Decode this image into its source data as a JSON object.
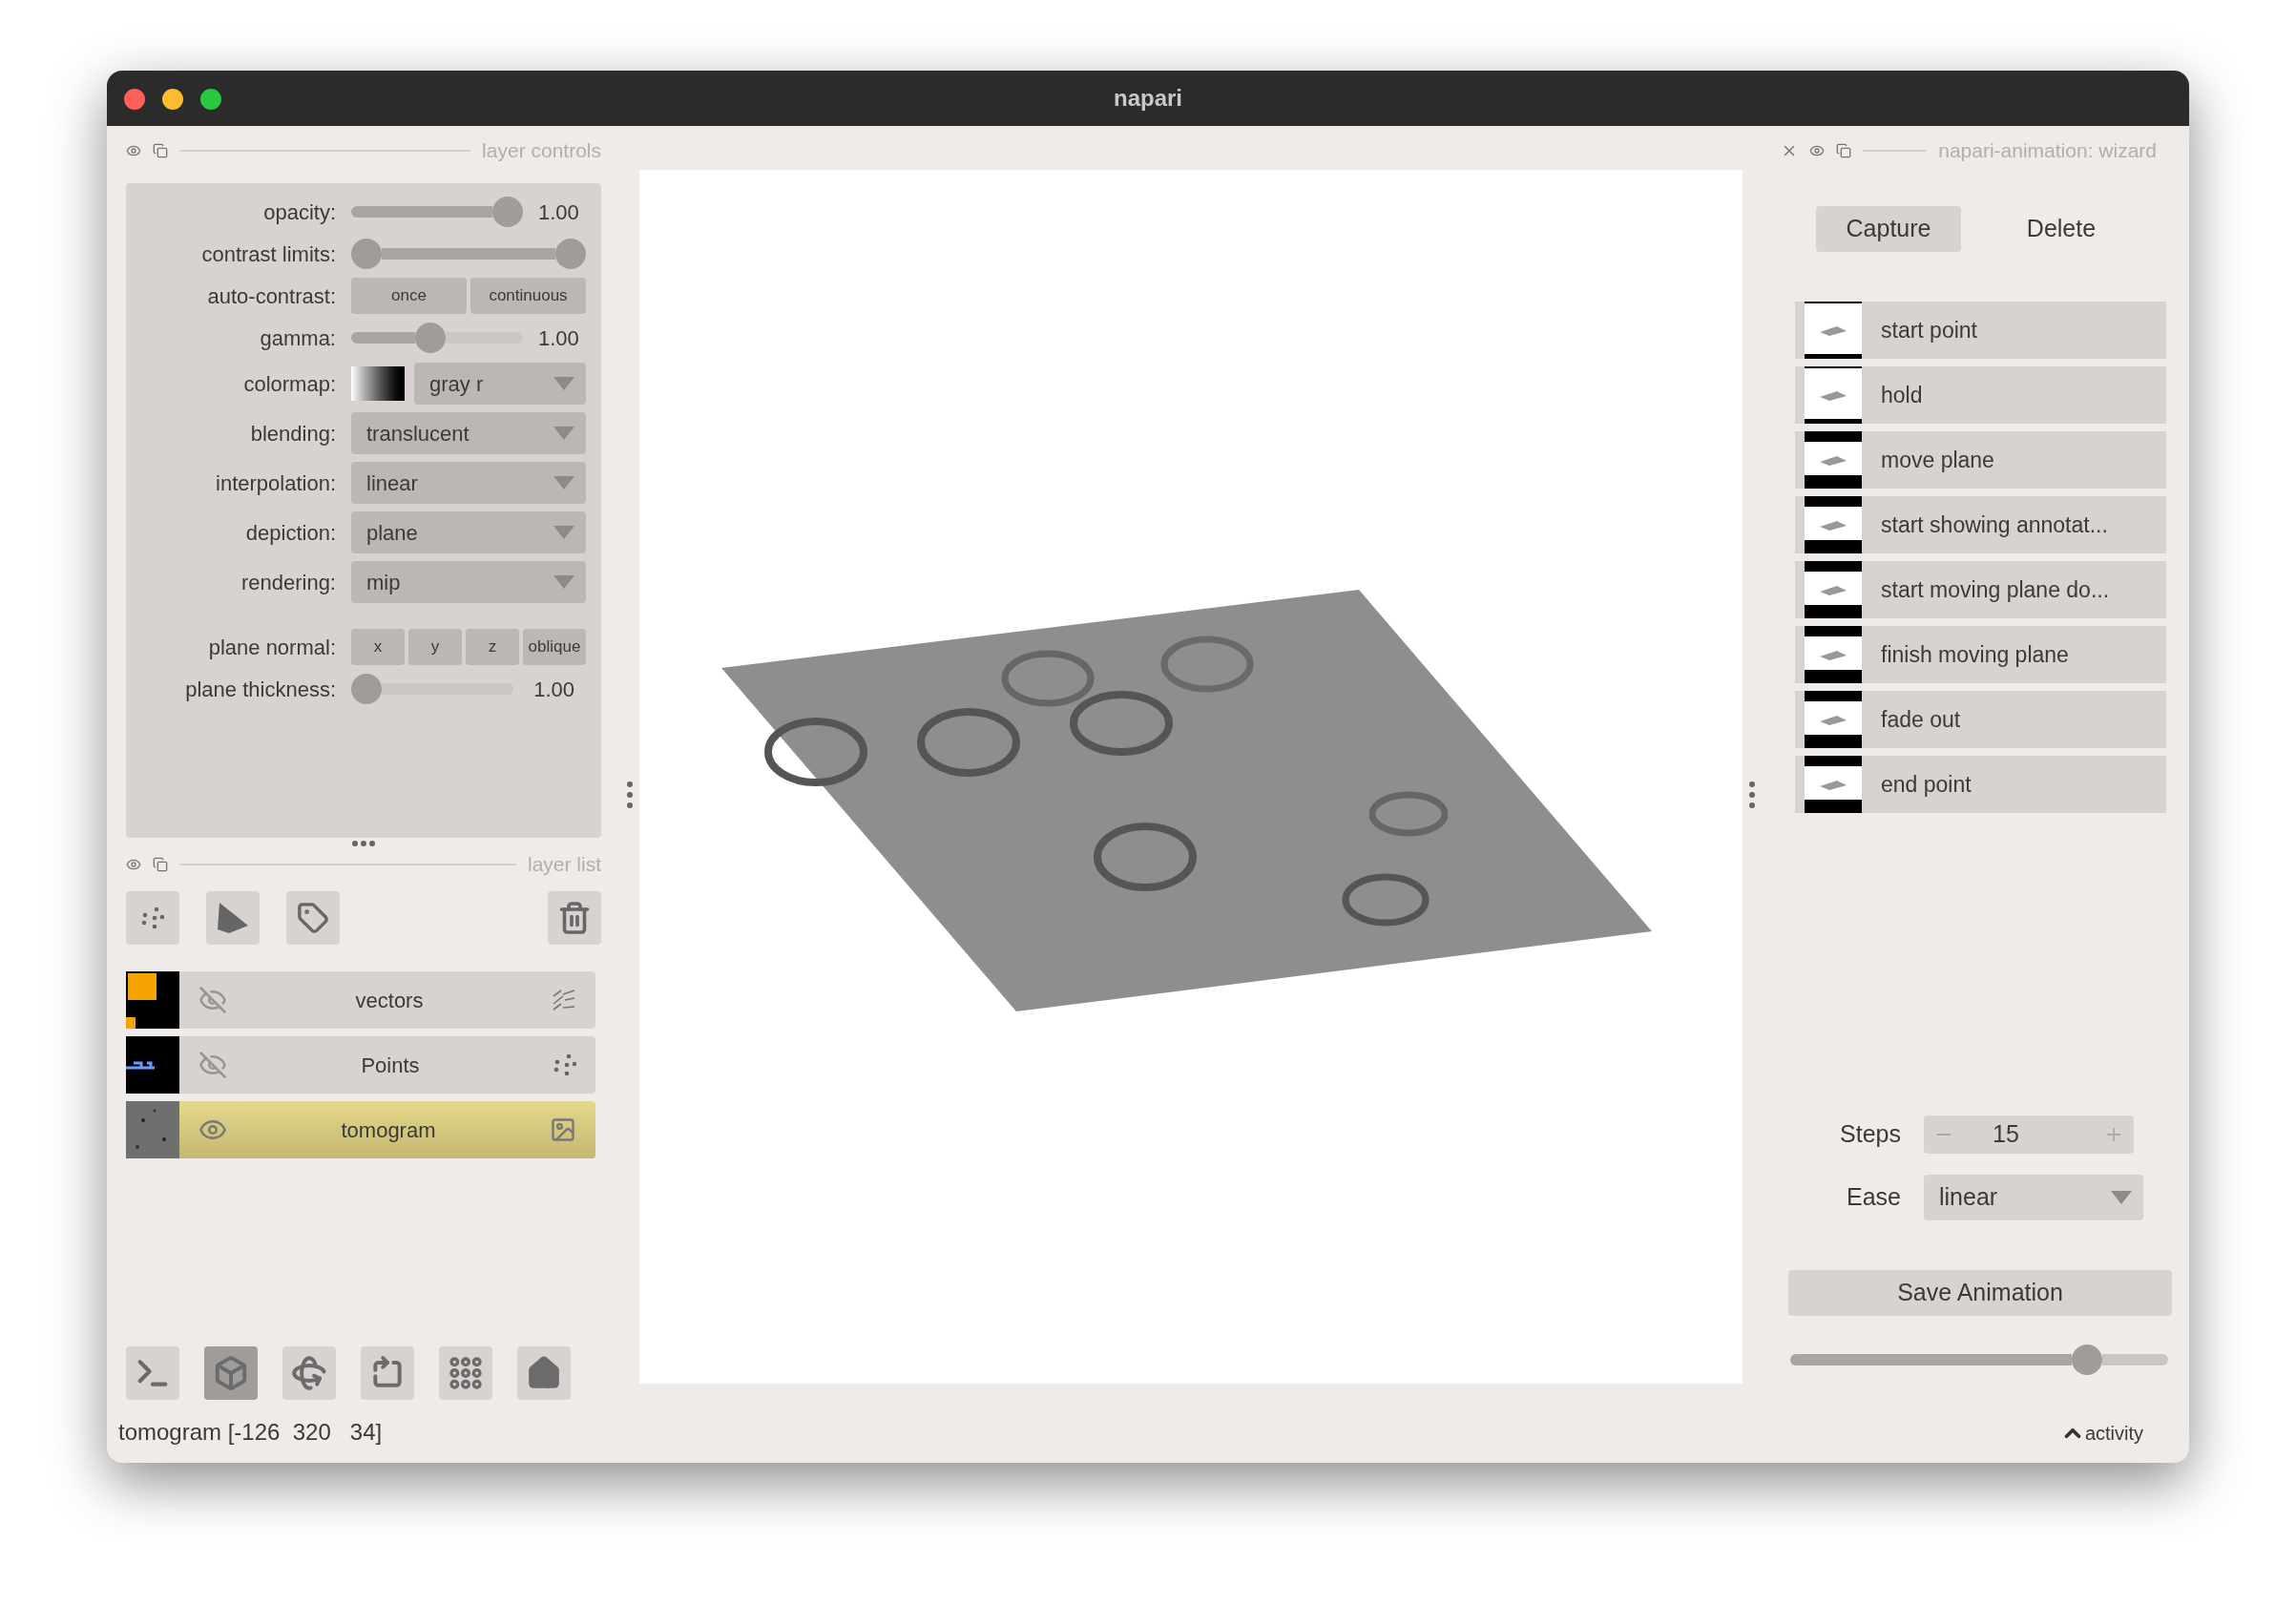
{
  "window": {
    "title": "napari"
  },
  "layer_controls": {
    "title": "layer controls",
    "rows": [
      {
        "kind": "slider",
        "label": "opacity:",
        "level": 1,
        "reading": "1.00"
      },
      {
        "kind": "range",
        "label": "contrast limits:",
        "thumbs": [
          {
            "level": 0
          },
          {
            "level": 1
          }
        ]
      },
      {
        "kind": "buttons",
        "label": "auto-contrast:",
        "buttons": [
          "once",
          "continuous"
        ]
      },
      {
        "kind": "slider",
        "label": "gamma:",
        "level": 0.45,
        "reading": "1.00"
      },
      {
        "kind": "colormap",
        "label": "colormap:",
        "value": "gray r"
      },
      {
        "kind": "dropdown",
        "label": "blending:",
        "value": "translucent"
      },
      {
        "kind": "dropdown",
        "label": "interpolation:",
        "value": "linear"
      },
      {
        "kind": "dropdown",
        "label": "depiction:",
        "value": "plane"
      },
      {
        "kind": "dropdown",
        "label": "rendering:",
        "value": "mip"
      },
      {
        "kind": "buttons",
        "label": "plane normal:",
        "buttons": [
          "x",
          "y",
          "z",
          "oblique"
        ]
      },
      {
        "kind": "slider",
        "label": "plane thickness:",
        "level": 0,
        "reading": "1.00"
      }
    ]
  },
  "layer_list": {
    "title": "layer list",
    "layers": [
      {
        "name": "vectors",
        "kind": "vectors",
        "visible": false,
        "selected": false
      },
      {
        "name": "Points",
        "kind": "points",
        "visible": false,
        "selected": false
      },
      {
        "name": "tomogram",
        "kind": "image",
        "visible": true,
        "selected": true
      }
    ]
  },
  "bottom_toolbar": [
    {
      "kind": "console",
      "selected": false
    },
    {
      "kind": "ndisplay",
      "selected": true
    },
    {
      "kind": "roll",
      "selected": false
    },
    {
      "kind": "transpose",
      "selected": false
    },
    {
      "kind": "grid",
      "selected": false
    },
    {
      "kind": "home",
      "selected": false
    }
  ],
  "status_bar": {
    "text": "tomogram [-126  320   34]",
    "activity": "activity"
  },
  "wizard": {
    "title": "napari-animation: wizard",
    "buttons": [
      "Capture",
      "Delete"
    ],
    "keyframes": [
      {
        "label": "start point"
      },
      {
        "label": "hold"
      },
      {
        "label": "move plane"
      },
      {
        "label": "start showing annotat..."
      },
      {
        "label": "start moving plane do..."
      },
      {
        "label": "finish moving plane"
      },
      {
        "label": "fade out"
      },
      {
        "label": "end point"
      }
    ],
    "steps_label": "Steps",
    "steps": "15",
    "ease_label": "Ease",
    "ease": "linear",
    "save": "Save Animation",
    "level": 0.81
  }
}
